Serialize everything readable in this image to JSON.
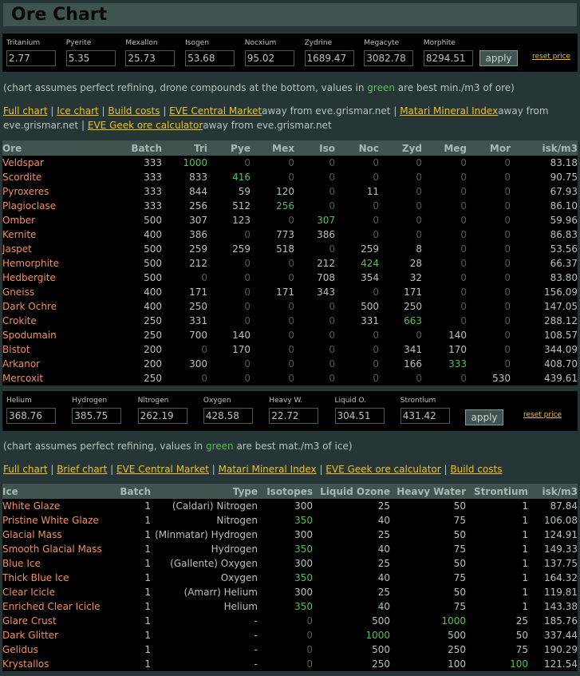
{
  "title": "Ore Chart",
  "ore_prices": {
    "fields": [
      {
        "label": "Tritanium",
        "value": "2.77"
      },
      {
        "label": "Pyerite",
        "value": "5.35"
      },
      {
        "label": "Mexallon",
        "value": "25.73"
      },
      {
        "label": "Isogen",
        "value": "53.68"
      },
      {
        "label": "Nocxium",
        "value": "95.02"
      },
      {
        "label": "Zydrine",
        "value": "1689.47"
      },
      {
        "label": "Megacyte",
        "value": "3082.78"
      },
      {
        "label": "Morphite",
        "value": "8294.51"
      }
    ],
    "apply": "apply",
    "reset": "reset price"
  },
  "ore_note": {
    "pre": "(chart assumes perfect refining, drone compounds at the bottom, values in ",
    "green": "green",
    "post": " are best min./m3 of ore)"
  },
  "ore_links": {
    "full": "Full chart",
    "ice": "Ice chart",
    "build": "Build costs",
    "central": "EVE Central Market",
    "away1": "away from eve.grismar.net",
    "matari": "Matari Mineral Index",
    "away2": "away from eve.grismar.net",
    "geek": "EVE Geek ore calculator",
    "away3": "away from eve.grismar.net",
    "sep": " | "
  },
  "ore_table": {
    "headers": [
      "Ore",
      "Batch",
      "Tri",
      "Pye",
      "Mex",
      "Iso",
      "Noc",
      "Zyd",
      "Meg",
      "Mor",
      "isk/m3"
    ],
    "rows": [
      {
        "cells": [
          "Veldspar",
          "333",
          "1000",
          "0",
          "0",
          "0",
          "0",
          "0",
          "0",
          "0",
          "83.18"
        ],
        "green": [
          2
        ]
      },
      {
        "cells": [
          "Scordite",
          "333",
          "833",
          "416",
          "0",
          "0",
          "0",
          "0",
          "0",
          "0",
          "90.75"
        ],
        "green": [
          3
        ]
      },
      {
        "cells": [
          "Pyroxeres",
          "333",
          "844",
          "59",
          "120",
          "0",
          "11",
          "0",
          "0",
          "0",
          "67.93"
        ],
        "green": []
      },
      {
        "cells": [
          "Plagioclase",
          "333",
          "256",
          "512",
          "256",
          "0",
          "0",
          "0",
          "0",
          "0",
          "86.10"
        ],
        "green": [
          4
        ]
      },
      {
        "cells": [
          "Omber",
          "500",
          "307",
          "123",
          "0",
          "307",
          "0",
          "0",
          "0",
          "0",
          "59.96"
        ],
        "green": [
          5
        ]
      },
      {
        "cells": [
          "Kernite",
          "400",
          "386",
          "0",
          "773",
          "386",
          "0",
          "0",
          "0",
          "0",
          "86.83"
        ],
        "green": []
      },
      {
        "cells": [
          "Jaspet",
          "500",
          "259",
          "259",
          "518",
          "0",
          "259",
          "8",
          "0",
          "0",
          "53.56"
        ],
        "green": []
      },
      {
        "cells": [
          "Hemorphite",
          "500",
          "212",
          "0",
          "0",
          "212",
          "424",
          "28",
          "0",
          "0",
          "66.37"
        ],
        "green": [
          6
        ]
      },
      {
        "cells": [
          "Hedbergite",
          "500",
          "0",
          "0",
          "0",
          "708",
          "354",
          "32",
          "0",
          "0",
          "83.80"
        ],
        "green": []
      },
      {
        "cells": [
          "Gneiss",
          "400",
          "171",
          "0",
          "171",
          "343",
          "0",
          "171",
          "0",
          "0",
          "156.09"
        ],
        "green": []
      },
      {
        "cells": [
          "Dark Ochre",
          "400",
          "250",
          "0",
          "0",
          "0",
          "500",
          "250",
          "0",
          "0",
          "147.05"
        ],
        "green": []
      },
      {
        "cells": [
          "Crokite",
          "250",
          "331",
          "0",
          "0",
          "0",
          "331",
          "663",
          "0",
          "0",
          "288.12"
        ],
        "green": [
          7
        ]
      },
      {
        "cells": [
          "Spodumain",
          "250",
          "700",
          "140",
          "0",
          "0",
          "0",
          "0",
          "140",
          "0",
          "108.57"
        ],
        "green": []
      },
      {
        "cells": [
          "Bistot",
          "200",
          "0",
          "170",
          "0",
          "0",
          "0",
          "341",
          "170",
          "0",
          "344.09"
        ],
        "green": []
      },
      {
        "cells": [
          "Arkanor",
          "200",
          "300",
          "0",
          "0",
          "0",
          "0",
          "166",
          "333",
          "0",
          "408.70"
        ],
        "green": [
          8
        ]
      },
      {
        "cells": [
          "Mercoxit",
          "250",
          "0",
          "0",
          "0",
          "0",
          "0",
          "0",
          "0",
          "530",
          "439.61"
        ],
        "green": []
      }
    ]
  },
  "ice_prices": {
    "fields": [
      {
        "label": "Helium",
        "value": "368.76"
      },
      {
        "label": "Hydrogen",
        "value": "385.75"
      },
      {
        "label": "Nitrogen",
        "value": "262.19"
      },
      {
        "label": "Oxygen",
        "value": "428.58"
      },
      {
        "label": "Heavy W.",
        "value": "22.72"
      },
      {
        "label": "Liquid O.",
        "value": "304.51"
      },
      {
        "label": "Strontium",
        "value": "431.42"
      }
    ],
    "apply": "apply",
    "reset": "reset price"
  },
  "ice_note": {
    "pre": "(chart assumes perfect refining, values in ",
    "green": "green",
    "post": " are best mat./m3 of ice)"
  },
  "ice_links": {
    "full": "Full chart",
    "brief": "Brief chart",
    "central": "EVE Central Market",
    "matari": "Matari Mineral Index",
    "geek": "EVE Geek ore calculator",
    "build": "Build costs",
    "sep": " | "
  },
  "ice_table": {
    "headers": [
      "Ice",
      "Batch",
      "Type",
      "Isotopes",
      "Liquid Ozone",
      "Heavy Water",
      "Strontium",
      "isk/m3"
    ],
    "rows": [
      {
        "cells": [
          "White Glaze",
          "1",
          "(Caldari) Nitrogen",
          "300",
          "25",
          "50",
          "1",
          "87.84"
        ],
        "green": []
      },
      {
        "cells": [
          "Pristine White Glaze",
          "1",
          "Nitrogen",
          "350",
          "40",
          "75",
          "1",
          "106.08"
        ],
        "green": [
          3
        ]
      },
      {
        "cells": [
          "Glacial Mass",
          "1",
          "(Minmatar) Hydrogen",
          "300",
          "25",
          "50",
          "1",
          "124.91"
        ],
        "green": []
      },
      {
        "cells": [
          "Smooth Glacial Mass",
          "1",
          "Hydrogen",
          "350",
          "40",
          "75",
          "1",
          "149.33"
        ],
        "green": [
          3
        ]
      },
      {
        "cells": [
          "Blue Ice",
          "1",
          "(Gallente) Oxygen",
          "300",
          "25",
          "50",
          "1",
          "137.75"
        ],
        "green": []
      },
      {
        "cells": [
          "Thick Blue Ice",
          "1",
          "Oxygen",
          "350",
          "40",
          "75",
          "1",
          "164.32"
        ],
        "green": [
          3
        ]
      },
      {
        "cells": [
          "Clear Icicle",
          "1",
          "(Amarr) Helium",
          "300",
          "25",
          "50",
          "1",
          "119.81"
        ],
        "green": []
      },
      {
        "cells": [
          "Enriched Clear Icicle",
          "1",
          "Helium",
          "350",
          "40",
          "75",
          "1",
          "143.38"
        ],
        "green": [
          3
        ]
      },
      {
        "cells": [
          "Glare Crust",
          "1",
          "-",
          "0",
          "500",
          "1000",
          "25",
          "185.76"
        ],
        "green": [
          5
        ]
      },
      {
        "cells": [
          "Dark Glitter",
          "1",
          "-",
          "0",
          "1000",
          "500",
          "50",
          "337.44"
        ],
        "green": [
          4
        ]
      },
      {
        "cells": [
          "Gelidus",
          "1",
          "-",
          "0",
          "500",
          "250",
          "75",
          "190.29"
        ],
        "green": []
      },
      {
        "cells": [
          "Krystallos",
          "1",
          "-",
          "0",
          "250",
          "100",
          "100",
          "121.54"
        ],
        "green": [
          6
        ]
      }
    ]
  }
}
